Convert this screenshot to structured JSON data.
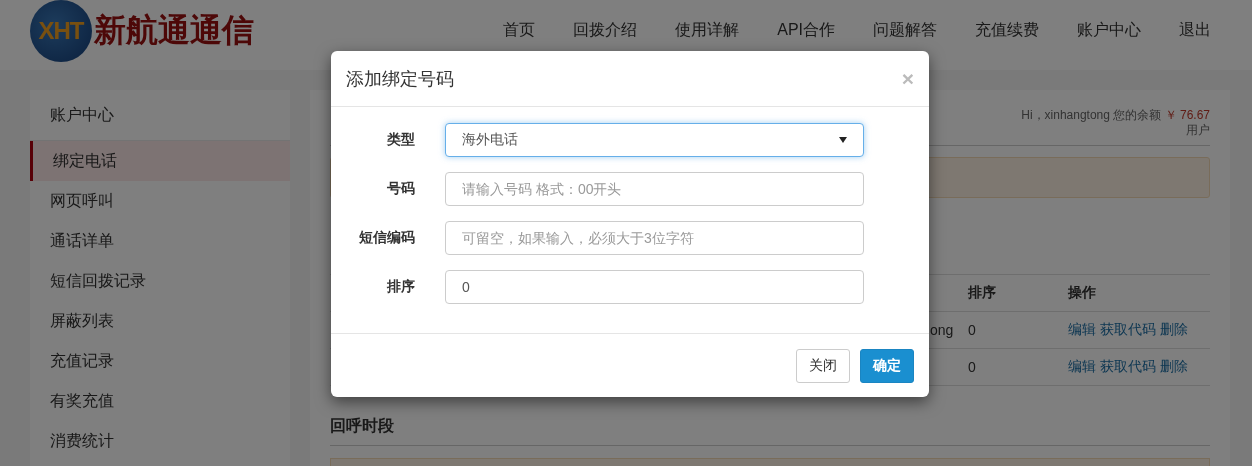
{
  "logo": {
    "mark": "XHT",
    "name": "新航通通信"
  },
  "nav": [
    {
      "label": "首页"
    },
    {
      "label": "回拨介绍"
    },
    {
      "label": "使用详解"
    },
    {
      "label": "API合作"
    },
    {
      "label": "问题解答"
    },
    {
      "label": "充值续费"
    },
    {
      "label": "账户中心"
    },
    {
      "label": "退出"
    }
  ],
  "sidebar": {
    "title": "账户中心",
    "items": [
      {
        "label": "绑定电话",
        "selected": true
      },
      {
        "label": "网页呼叫",
        "selected": false
      },
      {
        "label": "通话详单",
        "selected": false
      },
      {
        "label": "短信回拨记录",
        "selected": false
      },
      {
        "label": "屏蔽列表",
        "selected": false
      },
      {
        "label": "充值记录",
        "selected": false
      },
      {
        "label": "有奖充值",
        "selected": false
      },
      {
        "label": "消费统计",
        "selected": false
      }
    ]
  },
  "account": {
    "greeting": "Hi，xinhangtong 您的余额",
    "balance": "￥ 76.67",
    "role": "用户"
  },
  "table": {
    "columns": [
      {
        "label": "排序"
      },
      {
        "label": "操作"
      }
    ],
    "rows": [
      {
        "column_1": "ong",
        "sort": "0",
        "actions": [
          "编辑",
          "获取代码",
          "删除"
        ]
      },
      {
        "sort": "0",
        "actions": [
          "编辑",
          "获取代码",
          "删除"
        ]
      }
    ]
  },
  "section": {
    "title": "回呼时段"
  },
  "dialog": {
    "title": "添加绑定号码",
    "close": "×",
    "fields": [
      {
        "label": "类型",
        "kind": "select",
        "value": "海外电话",
        "focused": true
      },
      {
        "label": "号码",
        "kind": "input",
        "placeholder": "请输入号码 格式：00开头",
        "focused": false
      },
      {
        "label": "短信编码",
        "kind": "input",
        "placeholder": "可留空，如果输入，必须大于3位字符",
        "focused": false
      },
      {
        "label": "排序",
        "kind": "input",
        "value": "0",
        "focused": false
      }
    ],
    "buttons": [
      {
        "label": "关闭",
        "kind": "default"
      },
      {
        "label": "确定",
        "kind": "primary"
      }
    ]
  }
}
